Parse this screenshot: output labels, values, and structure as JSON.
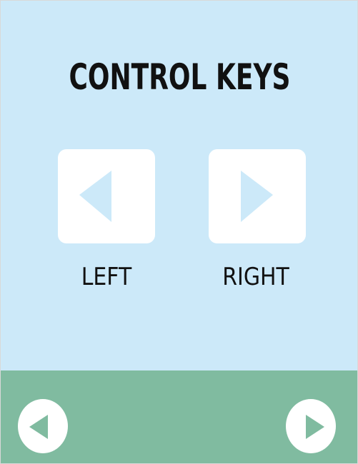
{
  "screen": {
    "title": "CONTROL KEYS"
  },
  "controls": [
    {
      "label": "LEFT",
      "icon": "triangle-left-icon"
    },
    {
      "label": "RIGHT",
      "icon": "triangle-right-icon"
    }
  ],
  "navigation": {
    "prev_icon": "triangle-left-icon",
    "next_icon": "triangle-right-icon"
  },
  "colors": {
    "background": "#cce9f9",
    "bottom_bar": "#80bba0",
    "key_face": "#ffffff",
    "key_arrow": "#cce9f9",
    "nav_arrow": "#80bba0",
    "text": "#111111"
  }
}
